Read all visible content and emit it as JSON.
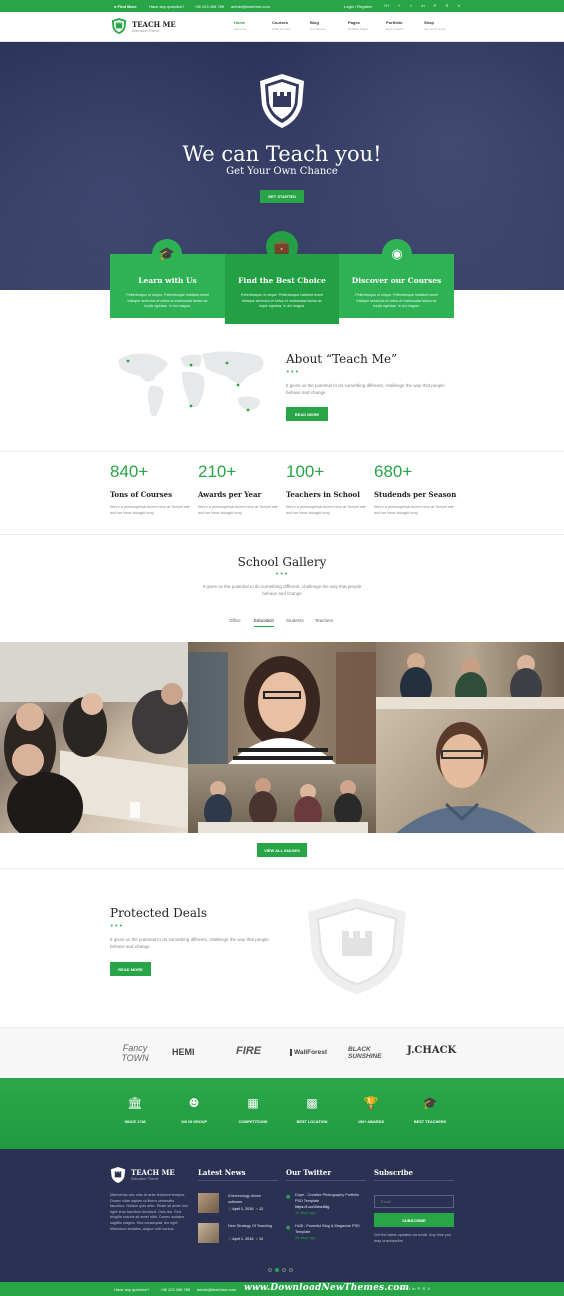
{
  "topbar": {
    "find_more": "Find More",
    "question": "Have any question?",
    "phone": "+38 123 456 789",
    "email": "admin@teachme.com",
    "auth": "Login / Register",
    "social": [
      "G+",
      "f",
      "t",
      "in",
      "P",
      "S",
      "V"
    ]
  },
  "brand": {
    "name": "TEACH ME",
    "tagline": "Education Theme"
  },
  "nav": [
    {
      "label": "Home",
      "sub": "About Us"
    },
    {
      "label": "Courses",
      "sub": "What we offer"
    },
    {
      "label": "Blog",
      "sub": "Our Stories"
    },
    {
      "label": "Pages",
      "sub": "Detailed Pages"
    },
    {
      "label": "Portfolio",
      "sub": "Best Projects"
    },
    {
      "label": "Shop",
      "sub": "Get some study"
    }
  ],
  "hero": {
    "title": "We can Teach you!",
    "subtitle": "Get Your Own Chance",
    "cta": "GET STARTED"
  },
  "features": [
    {
      "title": "Learn with Us",
      "text": "Pellentesque ut neque. Pellentesque habitant morbi tristique senectus et netus et malesuada fames ac turpis egestas. In dui magna.",
      "icon": "graduation-cap-icon"
    },
    {
      "title": "Find the Best Choice",
      "text": "Pellentesque ut neque. Pellentesque habitant morbi tristique senectus et netus et malesuada fames ac turpis egestas. In dui magna.",
      "icon": "briefcase-icon"
    },
    {
      "title": "Discover our Courses",
      "text": "Pellentesque ut neque. Pellentesque habitant morbi tristique senectus et netus et malesuada fames ac turpis egestas. In dui magna.",
      "icon": "binoculars-icon"
    }
  ],
  "about": {
    "title": "About “Teach Me”",
    "text": "It gives us the potential to do something different, challenge the way that people behave and change",
    "button": "READ MORE"
  },
  "stats": [
    {
      "number": "840+",
      "label": "Tons of Courses",
      "text": "We're a philosophical bunch here at School site and we have thought long"
    },
    {
      "number": "210+",
      "label": "Awards per Year",
      "text": "We're a philosophical bunch here at School site and we have thought long"
    },
    {
      "number": "100+",
      "label": "Teachers in School",
      "text": "We're a philosophical bunch here at School site and we have thought long"
    },
    {
      "number": "680+",
      "label": "Studends per Season",
      "text": "We're a philosophical bunch here at School site and we have thought long"
    }
  ],
  "gallery": {
    "title": "School Gallery",
    "text": "It gives us the potential to do something different, challenge the way that people behave and change",
    "tabs": [
      "Office",
      "Education",
      "Students",
      "Teachers"
    ],
    "active_tab": "Education",
    "button": "VIEW ALL IMAGES"
  },
  "deals": {
    "title": "Protected Deals",
    "text": "It gives us the potential to do something different, challenge the way that people behave and change",
    "button": "READ MORE"
  },
  "clients": [
    {
      "name": "Fancy TOWN"
    },
    {
      "name": "HEMI"
    },
    {
      "name": "FIRE"
    },
    {
      "name": "WallForest"
    },
    {
      "name": "BLACK SUNSHINE"
    },
    {
      "name": "J.CHACK"
    }
  ],
  "achievements": [
    {
      "label": "SINCE 1748",
      "icon": "bank-icon"
    },
    {
      "label": "100 IN GROUP",
      "icon": "group-icon"
    },
    {
      "label": "COMPETITIONS",
      "icon": "gamepad-icon"
    },
    {
      "label": "BEST LOCATION",
      "icon": "map-icon"
    },
    {
      "label": "100+ AWARDS",
      "icon": "trophy-icon"
    },
    {
      "label": "BEST TEACHERS",
      "icon": "graduation-cap-icon"
    }
  ],
  "footer": {
    "about_text": "Maecenas nec odio et ante tincidunt tempus. Donec vitae sapien ut libero venenatis faucibus. Nullam quis ante. Etiam sit amet orci eget eros faucibus tincidunt. Duis leo. Sed fringilla mauris sit amet nibh. Donec sodales sagittis magna. Sed consequat, leo eget bibendum sodales, augue velit cursus",
    "news_title": "Latest News",
    "news": [
      {
        "title": "A technology driven software",
        "date": "April 1, 2016",
        "comments": "12"
      },
      {
        "title": "New Strategy Of Teaching",
        "date": "April 1, 2016",
        "comments": "12"
      }
    ],
    "twitter_title": "Our Twitter",
    "tweets": [
      {
        "text": "Dope - Creative Photography Portfolio PSD Template",
        "link": "https://t.co/Cleonl6lg",
        "time": "12 days ago"
      },
      {
        "text": "HUB - Powerful Blog & Magazine PSD Template",
        "link": "",
        "time": "26 days ago"
      }
    ],
    "subscribe_title": "Subscribe",
    "email_placeholder": "Email",
    "subscribe_button": "SUBSCRIBE",
    "subscribe_text": "Get the latest updates via email. Any time you may unsubscribe"
  },
  "bottombar": {
    "question": "Have any question?",
    "phone": "+38 123 456 789",
    "email": "admin@teachme.com",
    "watermark": "www.DownloadNewThemes.com"
  },
  "colors": {
    "accent": "#27a547",
    "dark": "#2b3152"
  }
}
